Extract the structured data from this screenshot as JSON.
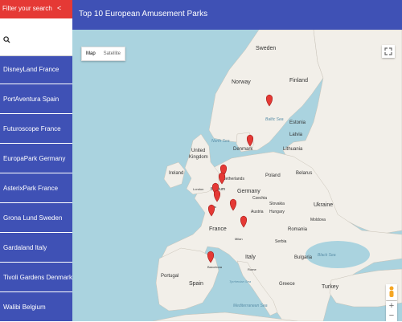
{
  "sidebar": {
    "search_title": "Filter your search",
    "close_symbol": "<",
    "search_placeholder": "",
    "items": [
      {
        "label": "DisneyLand France"
      },
      {
        "label": "PortAventura Spain"
      },
      {
        "label": "Futuroscope France"
      },
      {
        "label": "EuropaPark Germany"
      },
      {
        "label": "AsterixPark France"
      },
      {
        "label": "Grona Lund Sweden"
      },
      {
        "label": "Gardaland Italy"
      },
      {
        "label": "Tivoli Gardens Denmark"
      },
      {
        "label": "Walibi Belgium"
      }
    ]
  },
  "header": {
    "title": "Top 10 European Amusement Parks"
  },
  "map": {
    "type_buttons": {
      "map": "Map",
      "satellite": "Satellite"
    },
    "zoom": {
      "in": "+",
      "out": "−"
    },
    "countries": {
      "sweden": "Sweden",
      "finland": "Finland",
      "norway": "Norway",
      "estonia": "Estonia",
      "latvia": "Latvia",
      "lithuania": "Lithuania",
      "denmark": "Denmark",
      "united_kingdom_1": "United",
      "united_kingdom_2": "Kingdom",
      "ireland": "Ireland",
      "netherlands": "Netherlands",
      "belgium": "Belgium",
      "germany": "Germany",
      "poland": "Poland",
      "belarus": "Belarus",
      "ukraine": "Ukraine",
      "czechia": "Czechia",
      "austria": "Austria",
      "france": "France",
      "italy": "Italy",
      "portugal": "Portugal",
      "spain": "Spain",
      "romania": "Romania",
      "bulgaria": "Bulgaria",
      "greece": "Greece",
      "turkey": "Turkey",
      "hungary": "Hungary",
      "serbia": "Serbia",
      "slovakia": "Slovakia",
      "moldova": "Moldova"
    },
    "seas": {
      "north_sea": "North Sea",
      "baltic_sea": "Baltic Sea",
      "black_sea": "Black Sea",
      "tyrrhenian_sea": "Tyrrhenian Sea",
      "mediterranean_sea": "Mediterranean Sea"
    },
    "cities": {
      "london": "London",
      "paris": "Paris",
      "barcelona": "Barcelona",
      "milan": "Milan",
      "rome": "Rome"
    },
    "colors": {
      "marker": "#e53935",
      "land": "#f2efe9",
      "water": "#aad3df",
      "header": "#3f51b5",
      "accent": "#e53935"
    }
  }
}
